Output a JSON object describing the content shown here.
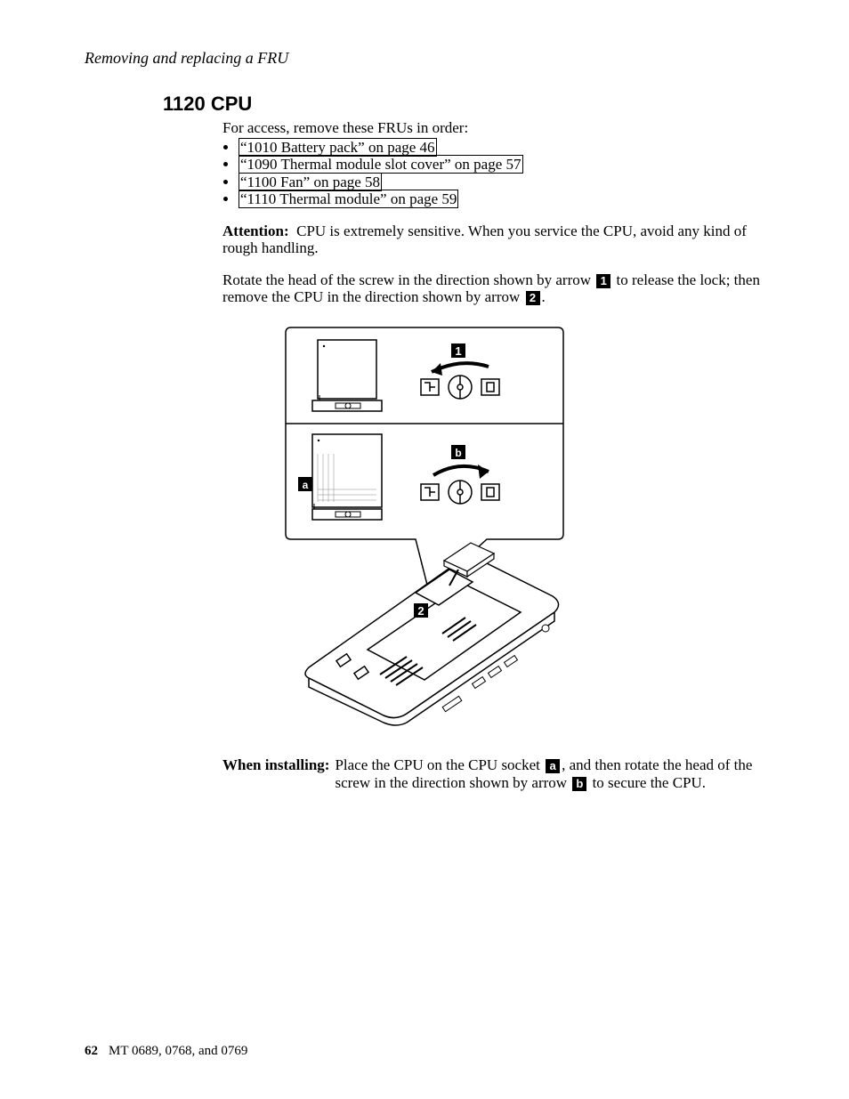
{
  "running_head": "Removing and replacing a FRU",
  "section_title": "1120 CPU",
  "intro": "For access, remove these FRUs in order:",
  "fru_links": [
    "“1010 Battery pack” on page 46",
    "“1090 Thermal module slot cover” on page 57",
    "“1100 Fan” on page 58",
    "“1110 Thermal module” on page 59"
  ],
  "attention_label": "Attention:",
  "attention_text": "CPU is extremely sensitive. When you service the CPU, avoid any kind of rough handling.",
  "rotate_1": "Rotate the head of the screw in the direction shown by arrow ",
  "rotate_2": " to release the lock; then remove the CPU in the direction shown by arrow ",
  "rotate_3": ".",
  "callout_1": "1",
  "callout_2": "2",
  "callout_a": "a",
  "callout_b": "b",
  "install_label": "When installing:",
  "install_1": "Place the CPU on the CPU socket ",
  "install_2": ", and then rotate the head of the screw in the direction shown by arrow ",
  "install_3": " to secure the CPU.",
  "footer_page": "62",
  "footer_text": "MT 0689, 0768, and 0769"
}
